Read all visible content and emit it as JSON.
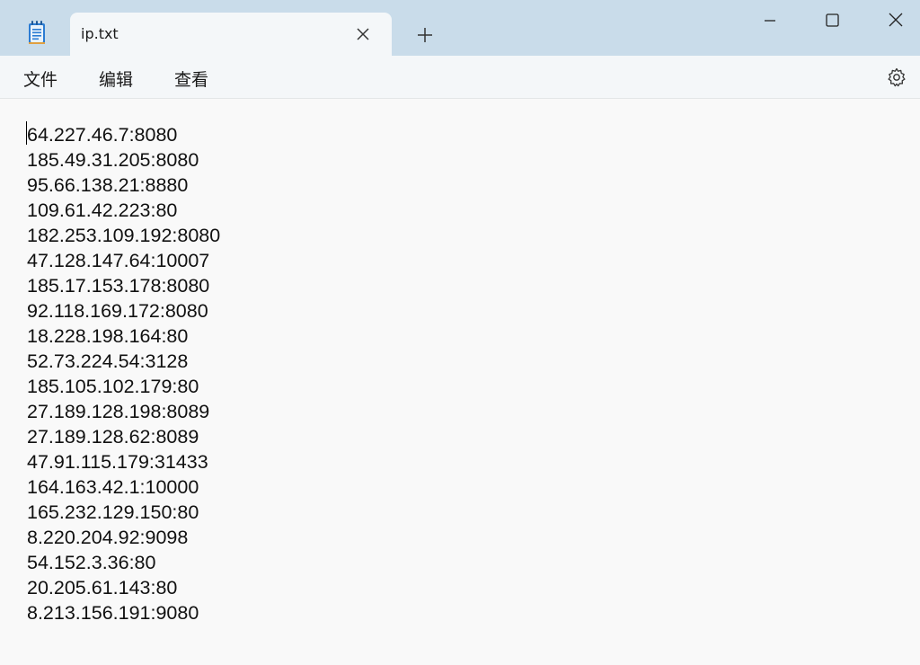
{
  "window": {
    "tab_title": "ip.txt",
    "icons": {
      "app": "notepad-icon",
      "close_tab": "close-icon",
      "new_tab": "plus-icon",
      "minimize": "minimize-icon",
      "maximize": "maximize-icon",
      "close_window": "close-icon",
      "settings": "gear-icon"
    }
  },
  "menu": {
    "file": "文件",
    "edit": "编辑",
    "view": "查看"
  },
  "document": {
    "lines": [
      "64.227.46.7:8080",
      "185.49.31.205:8080",
      "95.66.138.21:8880",
      "109.61.42.223:80",
      "182.253.109.192:8080",
      "47.128.147.64:10007",
      "185.17.153.178:8080",
      "92.118.169.172:8080",
      "18.228.198.164:80",
      "52.73.224.54:3128",
      "185.105.102.179:80",
      "27.189.128.198:8089",
      "27.189.128.62:8089",
      "47.91.115.179:31433",
      "164.163.42.1:10000",
      "165.232.129.150:80",
      "8.220.204.92:9098",
      "54.152.3.36:80",
      "20.205.61.143:80",
      "8.213.156.191:9080"
    ]
  },
  "colors": {
    "titlebar": "#c9dcea",
    "tab": "#f4f7f9",
    "editor": "#f9f9f9"
  }
}
